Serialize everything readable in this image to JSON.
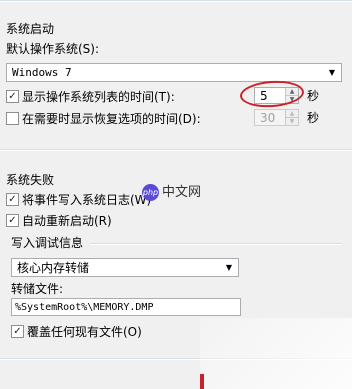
{
  "startup": {
    "group_title": "系统启动",
    "default_os_label": "默认操作系统(S):",
    "default_os_value": "Windows 7",
    "show_list_label": "显示操作系统列表的时间(T):",
    "show_list_checked": true,
    "show_list_value": "5",
    "show_list_unit": "秒",
    "show_recovery_label": "在需要时显示恢复选项的时间(D):",
    "show_recovery_checked": false,
    "show_recovery_value": "30",
    "show_recovery_unit": "秒"
  },
  "failure": {
    "group_title": "系统失败",
    "write_event_label": "将事件写入系统日志(W)",
    "write_event_checked": true,
    "auto_restart_label": "自动重新启动(R)",
    "auto_restart_checked": true
  },
  "debug": {
    "group_title": "写入调试信息",
    "dump_type_value": "核心内存转储",
    "dump_file_label": "转储文件:",
    "dump_file_value": "%SystemRoot%\\MEMORY.DMP",
    "overwrite_label": "覆盖任何现有文件(O)",
    "overwrite_checked": true
  },
  "watermark": {
    "logo_text": "php",
    "site_text": "中文网"
  },
  "colors": {
    "annotation_red": "#c8232c",
    "logo_purple": "#5a4bd6"
  }
}
